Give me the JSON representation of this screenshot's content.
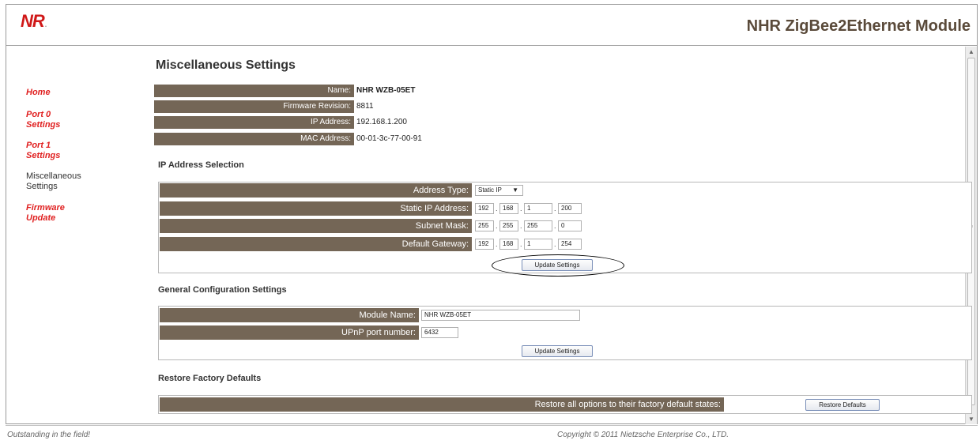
{
  "header": {
    "logo_text": "NR",
    "logo_mark": ".",
    "title": "NHR ZigBee2Ethernet Module"
  },
  "sidebar": {
    "items": [
      {
        "line1": "Home",
        "line2": ""
      },
      {
        "line1": "Port 0",
        "line2": "Settings"
      },
      {
        "line1": "Port 1",
        "line2": "Settings"
      },
      {
        "line1": "Miscellaneous",
        "line2": "Settings"
      },
      {
        "line1": "Firmware",
        "line2": "Update"
      }
    ]
  },
  "main": {
    "title": "Miscellaneous Settings",
    "info": [
      {
        "label": "Name:",
        "value": "NHR WZB-05ET"
      },
      {
        "label": "Firmware Revision:",
        "value": "8811"
      },
      {
        "label": "IP Address:",
        "value": "192.168.1.200"
      },
      {
        "label": "MAC Address:",
        "value": "00-01-3c-77-00-91"
      }
    ],
    "ip_section": {
      "title": "IP Address Selection",
      "address_type_label": "Address Type:",
      "address_type_value": "Static IP",
      "static_ip_label": "Static IP Address:",
      "static_ip": [
        "192",
        "168",
        "1",
        "200"
      ],
      "subnet_label": "Subnet Mask:",
      "subnet": [
        "255",
        "255",
        "255",
        "0"
      ],
      "gateway_label": "Default Gateway:",
      "gateway": [
        "192",
        "168",
        "1",
        "254"
      ],
      "update_label": "Update Settings"
    },
    "general_section": {
      "title": "General Configuration Settings",
      "module_name_label": "Module Name:",
      "module_name_value": "NHR WZB-05ET",
      "upnp_label": "UPnP port number:",
      "upnp_value": "6432",
      "update_label": "Update Settings"
    },
    "restore_section": {
      "title": "Restore Factory Defaults",
      "label": "Restore all options to their factory default states:",
      "button_label": "Restore Defaults"
    }
  },
  "footer": {
    "tagline": "Outstanding in the field!",
    "copyright": "Copyright © 2011 Nietzsche Enterprise Co., LTD."
  }
}
